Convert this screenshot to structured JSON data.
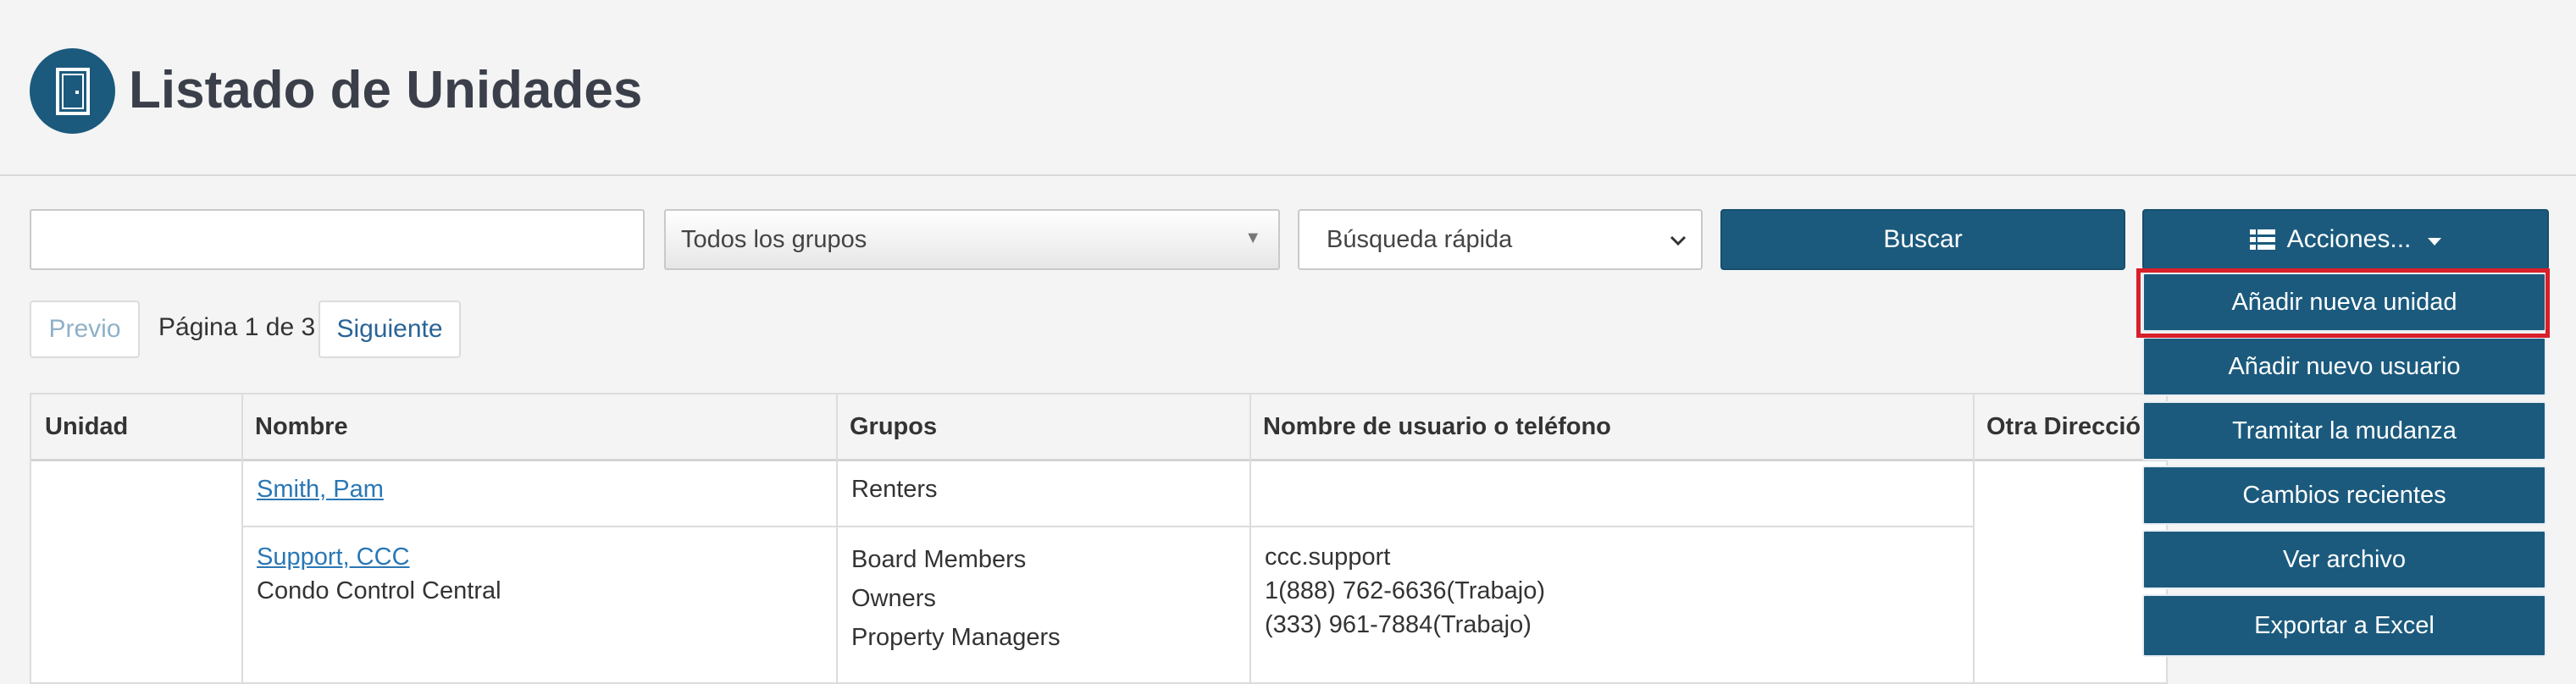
{
  "header": {
    "title": "Listado de Unidades",
    "icon": "door-icon"
  },
  "filters": {
    "search_value": "",
    "group_select": "Todos los grupos",
    "quick_select": "Búsqueda rápida",
    "search_button": "Buscar",
    "actions_button": "Acciones..."
  },
  "pagination": {
    "prev": "Previo",
    "info": "Página 1 de 3",
    "next": "Siguiente"
  },
  "table": {
    "columns": [
      "Unidad",
      "Nombre",
      "Grupos",
      "Nombre de usuario o teléfono",
      "Otra Dirección"
    ],
    "rows": [
      {
        "unit": "",
        "name": "Smith, Pam",
        "name_sub": "",
        "groups": [
          "Renters"
        ],
        "contact": []
      },
      {
        "unit": "",
        "name": "Support, CCC",
        "name_sub": "Condo Control Central",
        "groups": [
          "Board Members",
          "Owners",
          "Property Managers"
        ],
        "contact": [
          "ccc.support",
          "1(888) 762-6636(Trabajo)",
          "(333) 961-7884(Trabajo)"
        ]
      }
    ]
  },
  "actions_menu": {
    "items": [
      "Añadir nueva unidad",
      "Añadir nuevo usuario",
      "Tramitar la mudanza",
      "Cambios recientes",
      "Ver archivo",
      "Exportar a Excel"
    ]
  },
  "colors": {
    "primary": "#1b5a7d",
    "link": "#2a77b5",
    "highlight": "#d81f2a",
    "background": "#f4f4f4"
  }
}
